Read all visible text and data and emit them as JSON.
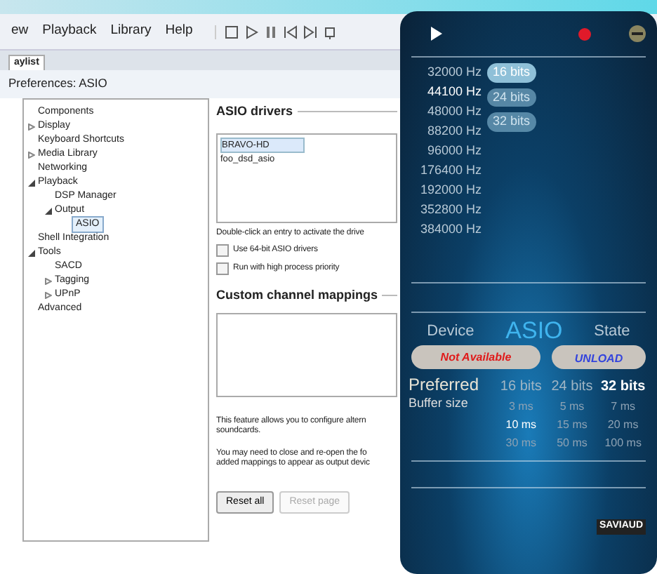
{
  "menu": [
    {
      "label": "ew"
    },
    {
      "label": "Playback"
    },
    {
      "label": "Library"
    },
    {
      "label": "Help"
    }
  ],
  "tab": {
    "label": "aylist"
  },
  "window_title": "Preferences: ASIO",
  "tree": [
    {
      "label": "Components"
    },
    {
      "label": "Display",
      "expanded": false
    },
    {
      "label": "Keyboard Shortcuts"
    },
    {
      "label": "Media Library",
      "expanded": false
    },
    {
      "label": "Networking"
    },
    {
      "label": "Playback",
      "expanded": true,
      "children": [
        {
          "label": "DSP Manager"
        },
        {
          "label": "Output",
          "expanded": true,
          "children": [
            {
              "label": "ASIO",
              "selected": true
            }
          ]
        }
      ]
    },
    {
      "label": "Shell Integration"
    },
    {
      "label": "Tools",
      "expanded": true,
      "children": [
        {
          "label": "SACD"
        },
        {
          "label": "Tagging",
          "expanded": false
        },
        {
          "label": "UPnP",
          "expanded": false
        }
      ]
    },
    {
      "label": "Advanced"
    }
  ],
  "drivers_heading": "ASIO drivers",
  "drivers": [
    {
      "label": "BRAVO-HD",
      "selected": true
    },
    {
      "label": "foo_dsd_asio",
      "selected": false
    }
  ],
  "drivers_hint": "Double-click an entry to activate the drive",
  "options": [
    {
      "label": "Use 64-bit ASIO drivers",
      "checked": false
    },
    {
      "label": "Run with high process priority",
      "checked": false
    }
  ],
  "mappings_heading": "Custom channel mappings",
  "notes": [
    [
      "This feature allows you to configure altern",
      "soundcards."
    ],
    [
      "You may need to close and re-open the fo",
      "added mappings to appear as output devic"
    ]
  ],
  "buttons": [
    {
      "label": "Reset all",
      "disabled": false
    },
    {
      "label": "Reset page",
      "disabled": true
    }
  ],
  "overlay": {
    "rates": [
      {
        "label": "32000 Hz",
        "selected": false
      },
      {
        "label": "44100 Hz",
        "selected": true
      },
      {
        "label": "48000 Hz",
        "selected": false
      },
      {
        "label": "88200 Hz",
        "selected": false
      },
      {
        "label": "96000 Hz",
        "selected": false
      },
      {
        "label": "176400 Hz",
        "selected": false
      },
      {
        "label": "192000 Hz",
        "selected": false
      },
      {
        "label": "352800 Hz",
        "selected": false
      },
      {
        "label": "384000 Hz",
        "selected": false
      }
    ],
    "bit_depths": [
      {
        "label": "16 bits",
        "selected": true
      },
      {
        "label": "24 bits",
        "selected": false
      },
      {
        "label": "32 bits",
        "selected": false
      }
    ],
    "device_label": "Device",
    "mode": "ASIO",
    "state_label": "State",
    "device_status": "Not Available",
    "state_button": "UNLOAD",
    "preferred": "Preferred",
    "buffer_label": "Buffer size",
    "buffer_bits": [
      {
        "label": "16 bits",
        "selected": false
      },
      {
        "label": "24 bits",
        "selected": false
      },
      {
        "label": "32 bits",
        "selected": true
      }
    ],
    "buffer_sizes": [
      {
        "label": "3 ms",
        "selected": false
      },
      {
        "label": "5 ms",
        "selected": false
      },
      {
        "label": "7 ms",
        "selected": false
      },
      {
        "label": "10 ms",
        "selected": true
      },
      {
        "label": "15 ms",
        "selected": false
      },
      {
        "label": "20 ms",
        "selected": false
      },
      {
        "label": "30 ms",
        "selected": false
      },
      {
        "label": "50 ms",
        "selected": false
      },
      {
        "label": "100 ms",
        "selected": false
      }
    ],
    "logo": "SAVIAUD"
  }
}
